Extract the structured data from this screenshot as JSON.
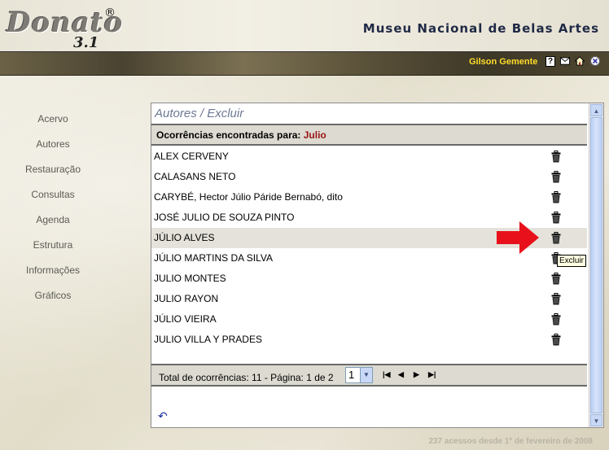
{
  "header": {
    "logo_text": "Donato",
    "logo_version": "3.1",
    "logo_reg": "®",
    "museum_title": "Museu Nacional de Belas Artes",
    "user_name": "Gilson Gemente",
    "icons": [
      "help-icon",
      "mail-icon",
      "home-icon",
      "exit-icon"
    ]
  },
  "sidebar": {
    "items": [
      {
        "label": "Acervo"
      },
      {
        "label": "Autores"
      },
      {
        "label": "Restauração"
      },
      {
        "label": "Consultas"
      },
      {
        "label": "Agenda"
      },
      {
        "label": "Estrutura"
      },
      {
        "label": "Informações"
      },
      {
        "label": "Gráficos"
      }
    ]
  },
  "main": {
    "title": "Autores / Excluir",
    "query_label": "Ocorrências encontradas para: ",
    "query_value": "Julio",
    "rows": [
      {
        "name": "ALEX CERVENY"
      },
      {
        "name": "CALASANS NETO"
      },
      {
        "name": "CARYBÉ, Hector Júlio Páride Bernabó, dito"
      },
      {
        "name": "JOSÉ JULIO DE SOUZA PINTO"
      },
      {
        "name": "JÚLIO ALVES"
      },
      {
        "name": "JÚLIO MARTINS DA SILVA"
      },
      {
        "name": "JULIO MONTES"
      },
      {
        "name": "JULIO RAYON"
      },
      {
        "name": "JÚLIO VIEIRA"
      },
      {
        "name": "JULIO VILLA Y PRADES"
      }
    ],
    "highlighted_row": 4,
    "footer": {
      "total_text": "Total de ocorrências: 11 - Página: 1 de 2",
      "page_selected": "1",
      "pager_icons": [
        "first-page-icon",
        "prev-page-icon",
        "next-page-icon",
        "last-page-icon"
      ]
    },
    "tooltip": "Excluir"
  },
  "access_note": "237 acessos desde 1º de fevereiro de 2008",
  "colors": {
    "band": "#4a4331",
    "user_name": "#ffde2a",
    "query_value": "#9a1414",
    "arrow": "#e8101a"
  }
}
